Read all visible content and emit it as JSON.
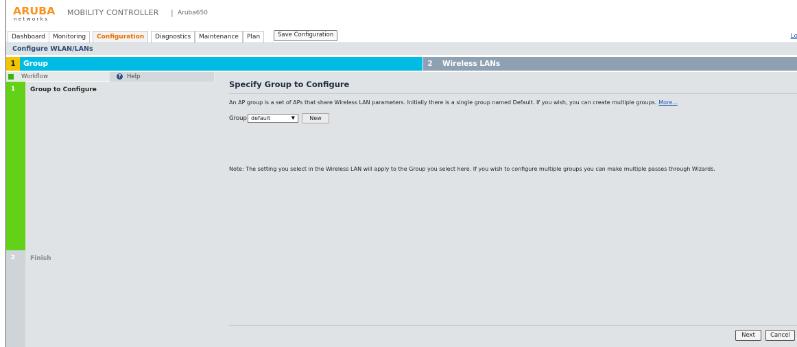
{
  "header": {
    "brand": "ARUBA",
    "brand_sub": "networks",
    "product": "MOBILITY CONTROLLER",
    "separator": "|",
    "device": "Aruba650",
    "logout": "Lo"
  },
  "nav": {
    "tabs": [
      {
        "label": "Dashboard",
        "active": false
      },
      {
        "label": "Monitoring",
        "active": false
      },
      {
        "label": "Configuration",
        "active": true
      },
      {
        "label": "Diagnostics",
        "active": false
      },
      {
        "label": "Maintenance",
        "active": false
      },
      {
        "label": "Plan",
        "active": false
      }
    ],
    "save_label": "Save Configuration"
  },
  "page_title": "Configure WLAN/LANs",
  "steps": [
    {
      "number": "1",
      "label": "Group",
      "active": true
    },
    {
      "number": "2",
      "label": "Wireless LANs",
      "active": false
    }
  ],
  "workflow": {
    "header_label": "Workflow",
    "help_label": "Help",
    "help_icon": "question-icon",
    "items": [
      {
        "number": "1",
        "label": "Group to Configure",
        "active": true
      },
      {
        "number": "2",
        "label": "Finish",
        "active": false
      }
    ]
  },
  "main": {
    "title": "Specify Group to Configure",
    "description": "An AP group is a set of APs that share Wireless LAN parameters. Initially there is a single group named Default. If you wish, you can create multiple groups.",
    "more_link": "More...",
    "group_label": "Group",
    "group_value": "default",
    "new_label": "New",
    "note": "Note: The setting you select in the Wireless LAN will apply to the Group you select here. If you wish to configure multiple groups you can make multiple passes through Wizards.",
    "next_label": "Next",
    "cancel_label": "Cancel"
  },
  "colors": {
    "brand": "#f7931e",
    "active_tab": "#e86f00",
    "step_active": "#00bce4",
    "step_inactive": "#8ea1b2",
    "workflow_active": "#63d117",
    "panel_bg": "#dfe3e6"
  }
}
